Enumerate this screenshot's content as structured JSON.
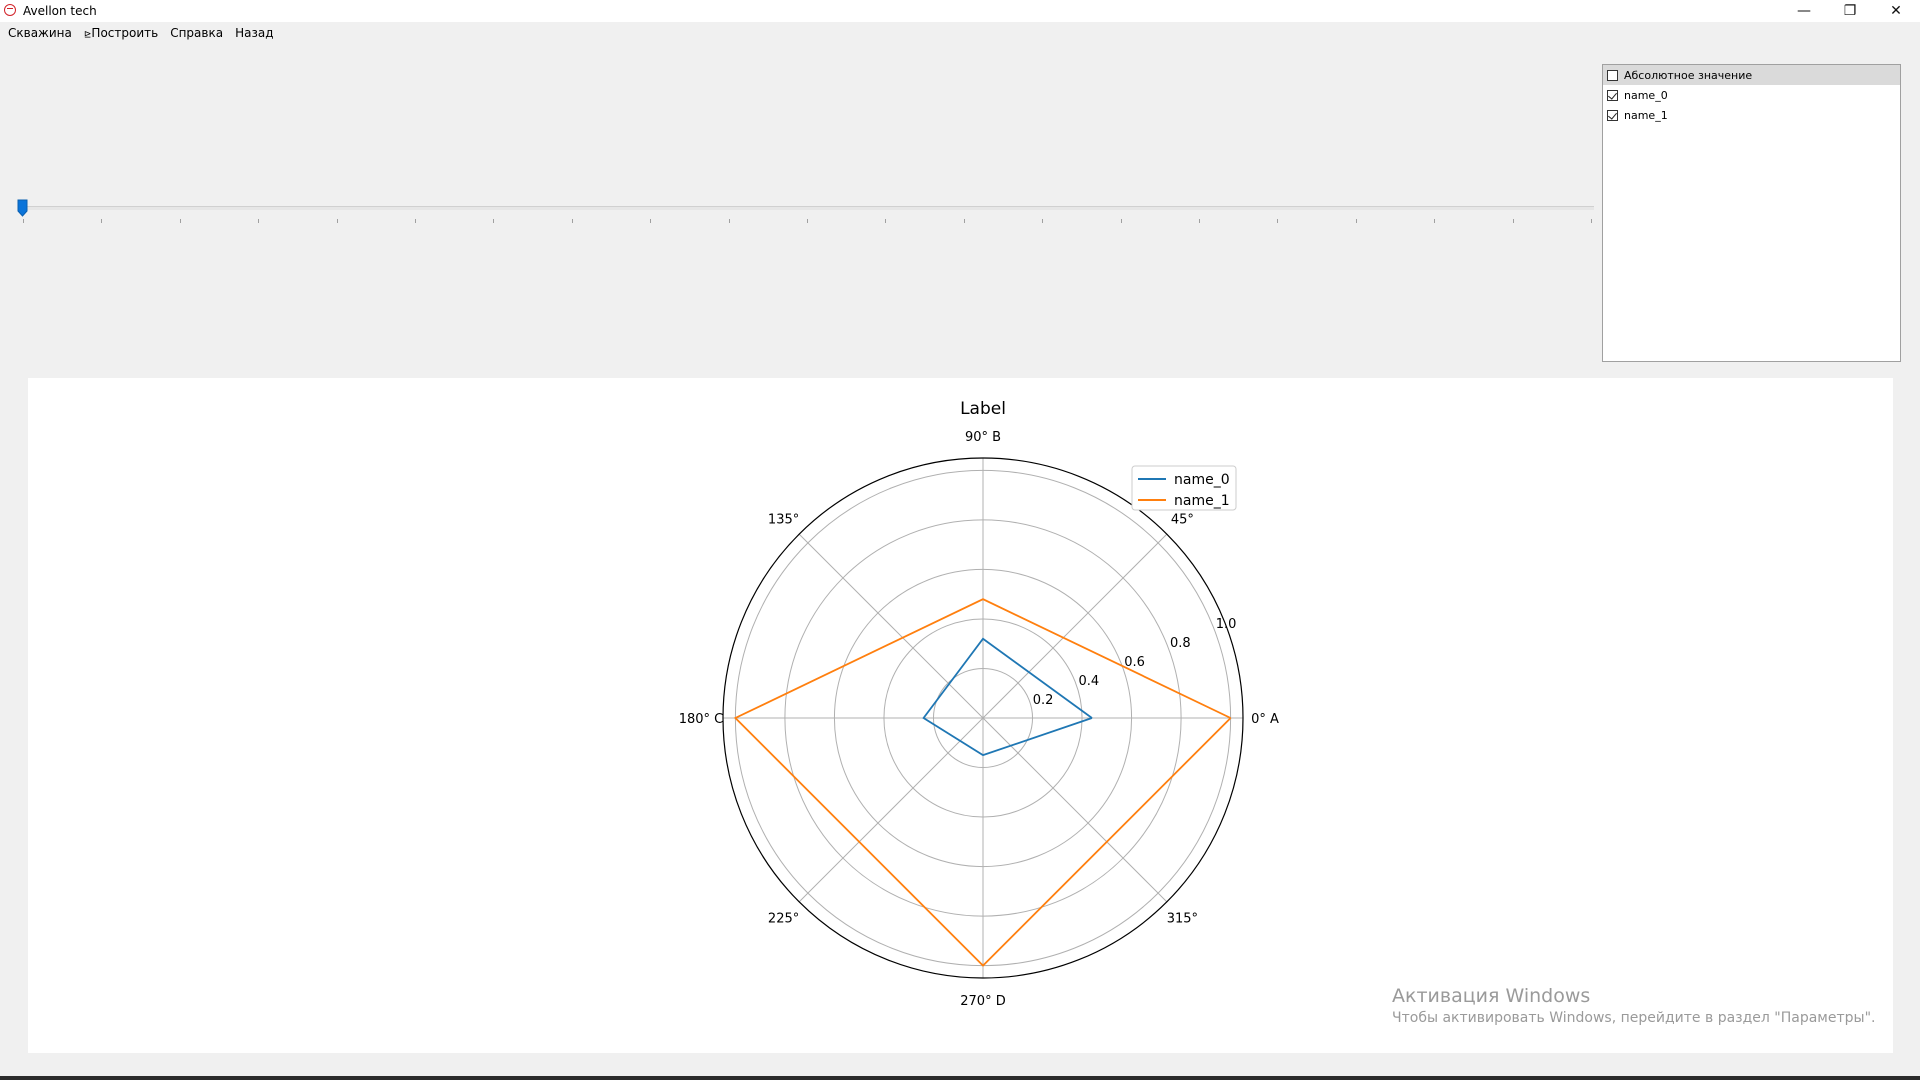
{
  "window": {
    "title": "Avellon tech",
    "minimize_glyph": "—",
    "restore_glyph": "❐",
    "close_glyph": "✕"
  },
  "menu": {
    "items": [
      {
        "label": "Скважина"
      },
      {
        "label": "Построить",
        "prefix": "⊵"
      },
      {
        "label": "Справка"
      },
      {
        "label": "Назад"
      }
    ]
  },
  "slider": {
    "value": 0,
    "tick_count": 21
  },
  "series_list": {
    "items": [
      {
        "label": "Абсолютное значение",
        "checked": false
      },
      {
        "label": "name_0",
        "checked": true
      },
      {
        "label": "name_1",
        "checked": true
      }
    ]
  },
  "chart_data": {
    "type": "polar-line",
    "title": "Label",
    "angle_ticks": [
      "0° A",
      "45°",
      "90° B",
      "135°",
      "180° C",
      "225°",
      "270° D",
      "315°"
    ],
    "radial_ticks": [
      "0.2",
      "0.4",
      "0.6",
      "0.8",
      "1.0"
    ],
    "rlim": [
      0,
      1.05
    ],
    "theta_deg": [
      0,
      90,
      180,
      270
    ],
    "series": [
      {
        "name": "name_0",
        "color": "#1f77b4",
        "values": [
          0.44,
          0.32,
          0.24,
          0.15
        ]
      },
      {
        "name": "name_1",
        "color": "#ff7f0e",
        "values": [
          1.0,
          0.48,
          1.0,
          1.0
        ]
      }
    ],
    "legend_position": "top-right",
    "grid": true
  },
  "watermark": {
    "line1": "Активация Windows",
    "line2": "Чтобы активировать Windows, перейдите в раздел \"Параметры\"."
  }
}
